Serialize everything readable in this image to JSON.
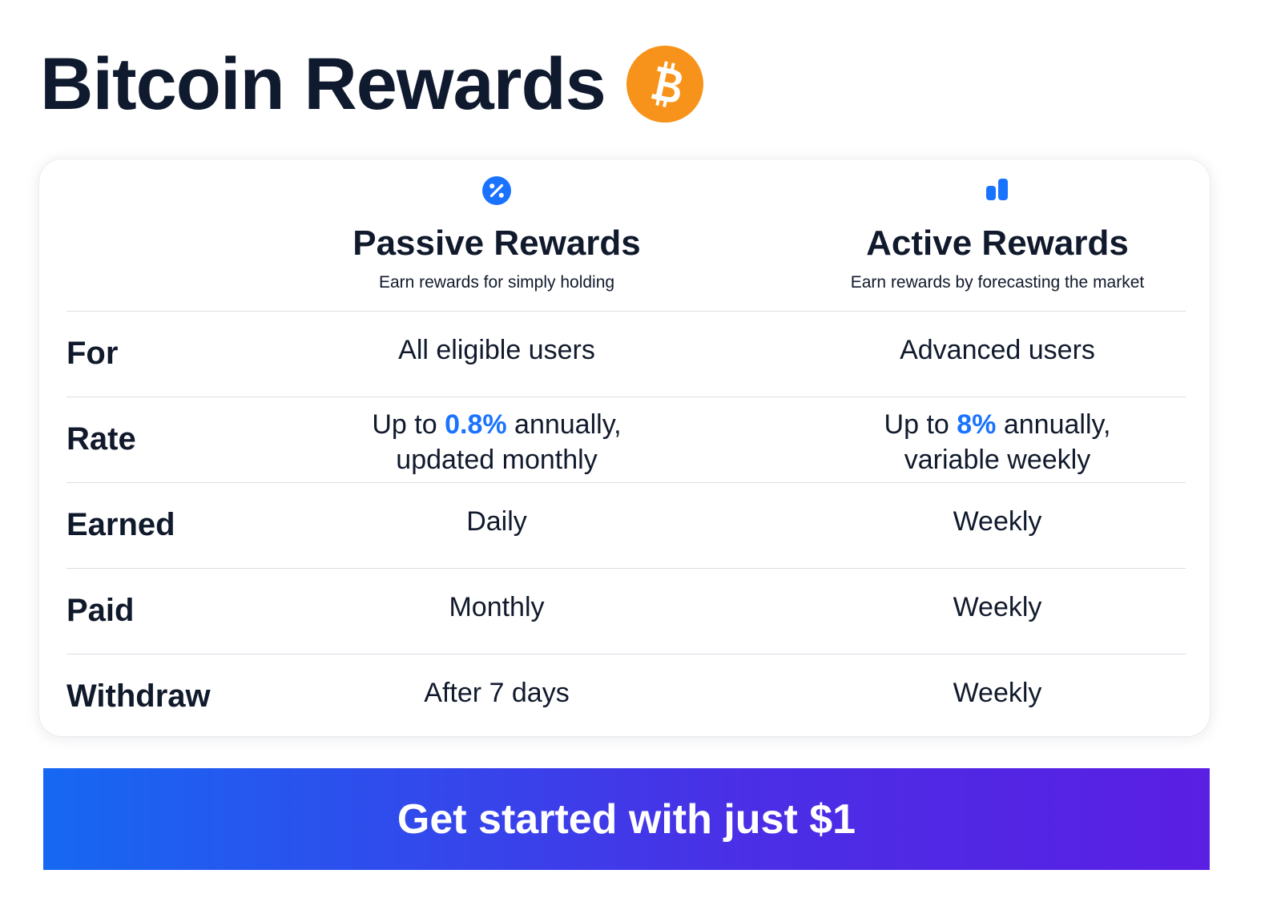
{
  "header": {
    "title": "Bitcoin Rewards",
    "coin_icon": "bitcoin-icon",
    "coin_color": "#f7931a"
  },
  "columns": [
    {
      "icon": "percent-icon",
      "title": "Passive Rewards",
      "subtitle": "Earn rewards for simply holding"
    },
    {
      "icon": "bar-chart-icon",
      "title": "Active Rewards",
      "subtitle": "Earn rewards by forecasting the market"
    }
  ],
  "rows": {
    "for": {
      "label": "For",
      "passive": "All eligible users",
      "active": "Advanced users"
    },
    "rate": {
      "label": "Rate",
      "passive": {
        "prefix": "Up to ",
        "value": "0.8%",
        "suffix": " annually,",
        "line2": "updated monthly"
      },
      "active": {
        "prefix": "Up to ",
        "value": "8%",
        "suffix": " annually,",
        "line2": "variable weekly"
      }
    },
    "earned": {
      "label": "Earned",
      "passive": "Daily",
      "active": "Weekly"
    },
    "paid": {
      "label": "Paid",
      "passive": "Monthly",
      "active": "Weekly"
    },
    "withdraw": {
      "label": "Withdraw",
      "passive": "After 7 days",
      "active": "Weekly"
    }
  },
  "cta": {
    "label": "Get started with just $1"
  },
  "colors": {
    "accent": "#1a73ff",
    "text": "#111a2c",
    "cta_gradient_start": "#1668f2",
    "cta_gradient_end": "#5a1fe3"
  }
}
